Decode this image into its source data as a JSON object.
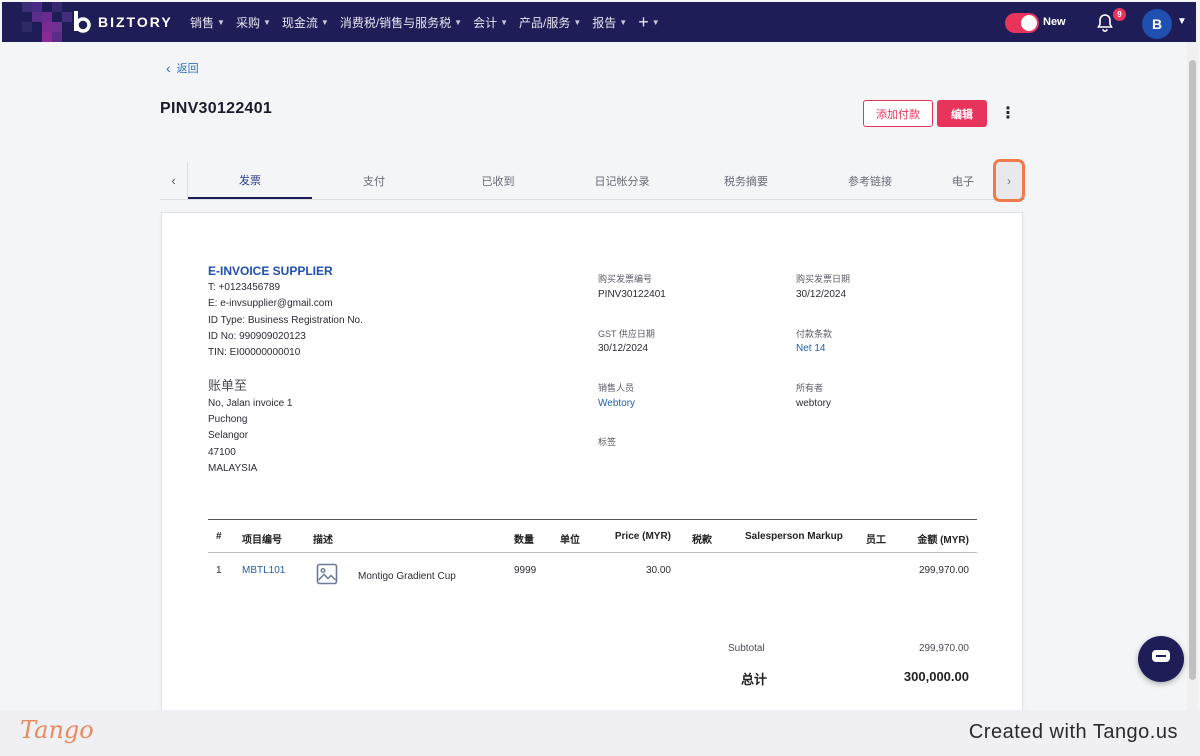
{
  "topbar": {
    "brand": "BIZTORY",
    "menu": [
      {
        "label": "销售"
      },
      {
        "label": "采购"
      },
      {
        "label": "现金流"
      },
      {
        "label": "消费税/销售与服务税"
      },
      {
        "label": "会计"
      },
      {
        "label": "产品/服务"
      },
      {
        "label": "报告"
      }
    ],
    "plus_label": "+",
    "toggle_label": "New",
    "notifications_count": "9",
    "avatar_initial": "B"
  },
  "page": {
    "back_label": "返回",
    "title": "PINV30122401",
    "add_payment_label": "添加付款",
    "edit_label": "编辑",
    "more_label": "⋮"
  },
  "tabs": [
    {
      "label": "发票",
      "active": true
    },
    {
      "label": "支付"
    },
    {
      "label": "已收到"
    },
    {
      "label": "日记帐分录"
    },
    {
      "label": "税务摘要"
    },
    {
      "label": "参考链接"
    },
    {
      "label": "电子"
    }
  ],
  "supplier": {
    "name": "E-INVOICE SUPPLIER",
    "phone": "T: +0123456789",
    "email": "E: e-invsupplier@gmail.com",
    "id_type": "ID Type: Business Registration No.",
    "id_no": "ID No: 990909020123",
    "tin": "TIN: EI00000000010"
  },
  "bill_to": {
    "label": "账单至",
    "lines": [
      "No, Jalan invoice 1",
      "Puchong",
      "Selangor",
      "47100",
      "MALAYSIA"
    ]
  },
  "meta": {
    "invoice_no_label": "购买发票编号",
    "invoice_no": "PINV30122401",
    "invoice_date_label": "购买发票日期",
    "invoice_date": "30/12/2024",
    "gst_date_label": "GST 供应日期",
    "gst_date": "30/12/2024",
    "terms_label": "付款条款",
    "terms": "Net 14",
    "salesperson_label": "销售人员",
    "salesperson": "Webtory",
    "owner_label": "所有者",
    "owner": "webtory",
    "tags_label": "标签"
  },
  "items_table": {
    "headers": {
      "no": "#",
      "code": "项目编号",
      "desc": "描述",
      "qty": "数量",
      "unit": "单位",
      "price": "Price (MYR)",
      "tax": "税款",
      "markup": "Salesperson Markup",
      "staff": "员工",
      "amount": "金额 (MYR)"
    },
    "rows": [
      {
        "no": "1",
        "code": "MBTL101",
        "desc": "Montigo Gradient Cup",
        "qty": "9999",
        "unit": "",
        "price": "30.00",
        "tax": "",
        "markup": "",
        "staff": "",
        "amount": "299,970.00"
      }
    ]
  },
  "totals": {
    "subtotal_label": "Subtotal",
    "subtotal": "299,970.00",
    "total_label": "总计",
    "total": "300,000.00"
  },
  "footer": {
    "brand": "Tango",
    "created": "Created with Tango.us"
  },
  "colors": {
    "nav": "#1f1d57",
    "accent": "#e8345a",
    "link": "#1f5fb0",
    "highlight": "#f07a4a"
  }
}
